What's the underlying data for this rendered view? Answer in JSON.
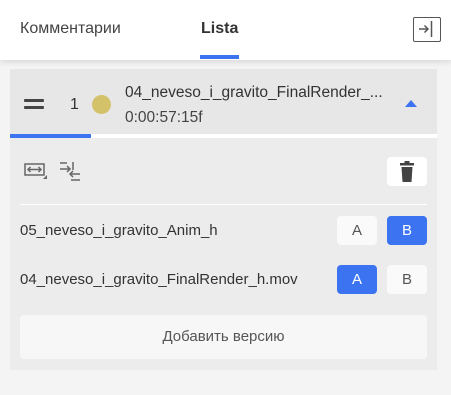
{
  "tabs": [
    {
      "label": "Комментарии",
      "active": false
    },
    {
      "label": "Lista",
      "active": true
    }
  ],
  "accent_color": "#3b73f0",
  "list_item": {
    "index": "1",
    "status_color": "#d4c26a",
    "title": "04_neveso_i_gravito_FinalRender_...",
    "duration": "0:00:57:15f",
    "progress": 0.19
  },
  "icons": {
    "collapse": "collapse-panel-icon",
    "drag": "drag-handle-icon",
    "expand": "chevron-up-icon",
    "fit": "fit-width-icon",
    "swap": "swap-versions-icon",
    "delete": "trash-icon"
  },
  "versions": [
    {
      "name": "05_neveso_i_gravito_Anim_h",
      "a_label": "A",
      "b_label": "B",
      "selected": "B"
    },
    {
      "name": "04_neveso_i_gravito_FinalRender_h.mov",
      "a_label": "A",
      "b_label": "B",
      "selected": "A"
    }
  ],
  "add_version_label": "Добавить версию"
}
